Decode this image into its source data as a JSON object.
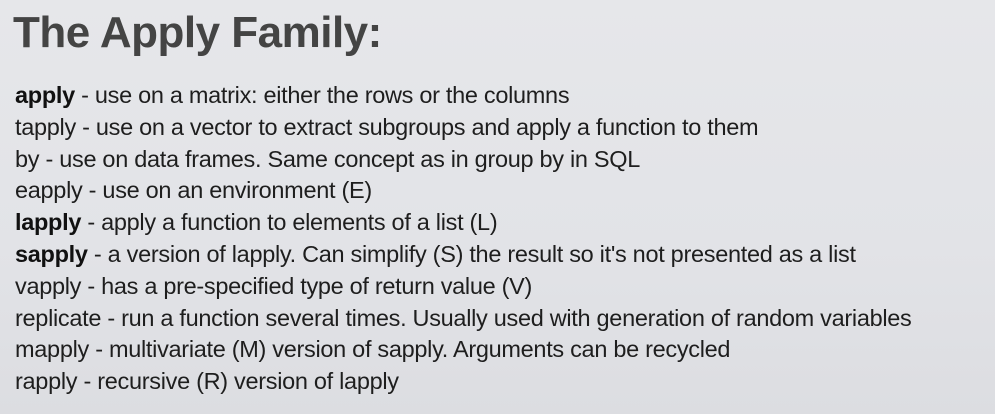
{
  "slide": {
    "title": "The Apply Family:",
    "items": [
      {
        "name": "apply",
        "bold": true,
        "desc": " - use on a matrix: either the rows or the columns"
      },
      {
        "name": "tapply",
        "bold": false,
        "desc": " - use on a vector to extract subgroups and apply a function to them"
      },
      {
        "name": "by",
        "bold": false,
        "desc": " - use on data frames. Same concept as in group by in SQL"
      },
      {
        "name": "eapply",
        "bold": false,
        "desc": " - use on an environment (E)"
      },
      {
        "name": "lapply",
        "bold": true,
        "desc": " - apply a function to elements of a list (L)"
      },
      {
        "name": "sapply",
        "bold": true,
        "desc": " - a version of lapply. Can simplify (S) the result so it's not presented as a list"
      },
      {
        "name": "vapply",
        "bold": false,
        "desc": " - has a pre-specified type of return value (V)"
      },
      {
        "name": "replicate",
        "bold": false,
        "desc": " - run a function several times. Usually used with generation of random variables"
      },
      {
        "name": "mapply",
        "bold": false,
        "desc": " - multivariate (M) version of sapply. Arguments can be recycled"
      },
      {
        "name": "rapply",
        "bold": false,
        "desc": " - recursive (R) version of lapply"
      }
    ]
  }
}
